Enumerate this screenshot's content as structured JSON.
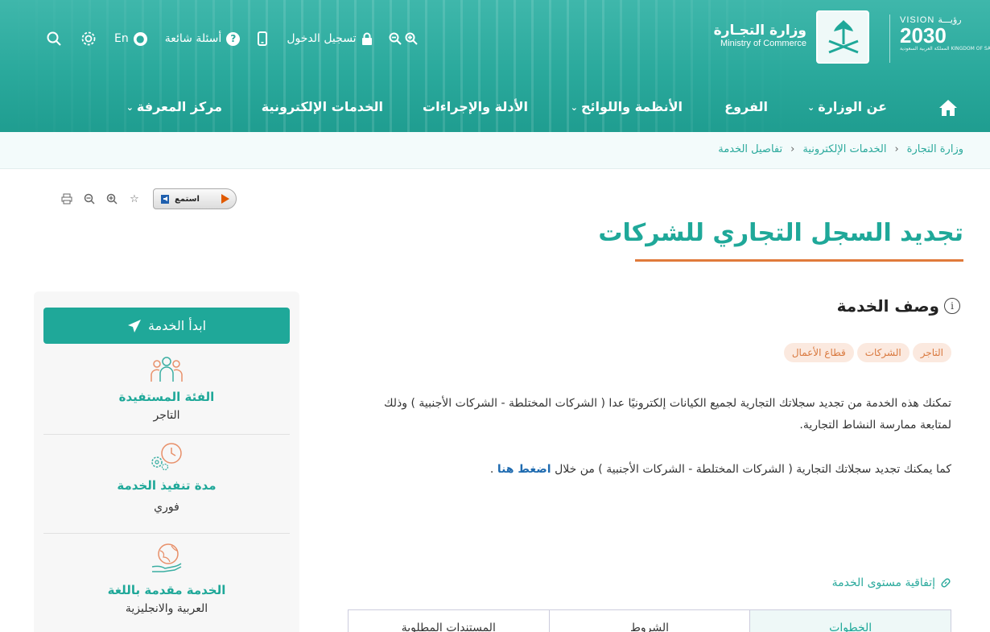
{
  "header": {
    "vision_text": "VISION",
    "vision_year": "2030",
    "vision_arabic": "رؤيـــة",
    "vision_kingdom": "المملكة العربية السعودية KINGDOM OF SAUDI ARABIA",
    "ministry_ar": "وزارة التجـارة",
    "ministry_en": "Ministry of Commerce",
    "utils": {
      "search_icon": "search-icon",
      "settings_icon": "gear-icon",
      "language": "En",
      "faq": "أسئلة شائعة",
      "login": "تسجيل الدخول",
      "zoom_in": "+",
      "zoom_out": "-"
    },
    "nav": [
      {
        "label": "عن الوزارة",
        "has_dropdown": true
      },
      {
        "label": "الفروع",
        "has_dropdown": false
      },
      {
        "label": "الأنظمة واللوائح",
        "has_dropdown": true
      },
      {
        "label": "الأدلة والإجراءات",
        "has_dropdown": false
      },
      {
        "label": "الخدمات الإلكترونية",
        "has_dropdown": false
      },
      {
        "label": "مركز المعرفة",
        "has_dropdown": true
      }
    ]
  },
  "breadcrumb": [
    "وزارة التجارة",
    "الخدمات الإلكترونية",
    "تفاصيل الخدمة"
  ],
  "tools": {
    "listen": "استمع"
  },
  "page": {
    "title": "تجديد السجل التجاري للشركات",
    "section_title": "وصف الخدمة",
    "tags": [
      "التاجر",
      "الشركات",
      "قطاع الأعمال"
    ],
    "desc1": "تمكنك هذه الخدمة من تجديد سجلاتك التجارية لجميع الكيانات إلكترونيًا عدا ( الشركات المختلطة - الشركات الأجنبية ) وذلك لمتابعة ممارسة النشاط التجارية.",
    "desc2": "كما يمكنك تجديد سجلاتك التجارية ( الشركات المختلطة - الشركات الأجنبية ) من خلال",
    "desc2_link": "اضغط هنا",
    "desc2_end": ".",
    "sla": "إتفاقية مستوى الخدمة",
    "tabs": [
      "الخطوات",
      "الشروط",
      "المستندات المطلوبة"
    ]
  },
  "sidebar": {
    "start": "ابدأ الخدمة",
    "beneficiary_title": "الفئة المستفيدة",
    "beneficiary_value": "التاجر",
    "duration_title": "مدة تنفيذ الخدمة",
    "duration_value": "فوري",
    "language_title": "الخدمة مقدمة باللغة",
    "language_value": "العربية والانجليزية"
  },
  "colors": {
    "primary": "#1fa899",
    "accent": "#e07a3b",
    "tag_bg": "#fbe9df",
    "link": "#1f6bb0"
  }
}
